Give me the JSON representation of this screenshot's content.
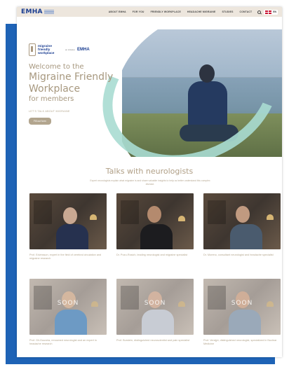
{
  "nav": {
    "logo": "EMHA",
    "links": [
      "ABOUT EMHA",
      "FOR YOU",
      "FRIENDLY WORKPLACE",
      "HEADACHE MIGRAINE",
      "STUDIES",
      "CONTACT"
    ],
    "language": "EN"
  },
  "hero": {
    "program_logo": "migraine friendly workplace",
    "join_text": "an initiative",
    "emha_mark": "EMHA",
    "welcome": "Welcome to the",
    "title": "Migraine Friendly Workplace",
    "subtitle": "for members",
    "tagline": "LET'S TALK ABOUT MIGRAINE",
    "cta": "Fill out form"
  },
  "talks": {
    "title": "Talks with neurologists",
    "subtitle": "Expert neurologists explain what migraine is and share valuable insights to help us better understand this complex disease.",
    "soon_label": "SOON",
    "cards": [
      {
        "caption": "Prof. Edvinsson, expert in the field of cerebral circulation and migraine research"
      },
      {
        "caption": "Dr. Pozo-Rosich, leading neurologist and migraine specialist"
      },
      {
        "caption": "Dr. Moreno, consultant neurologist and headache specialist"
      },
      {
        "caption": "Prof. Gil-Gouveia, renowned neurologist and an expert in headache research"
      },
      {
        "caption": "Prof. Burstein, distinguished neuroscientist and pain specialist"
      },
      {
        "caption": "Prof. Versijpt, distinguished neurologist, specialized in Nuclear Medicine"
      }
    ]
  },
  "colors": {
    "frame_blue": "#1e63b6",
    "brand_navy": "#1a3d91",
    "accent_beige": "#a7987f",
    "swirl_mint": "#a9dcd2"
  }
}
